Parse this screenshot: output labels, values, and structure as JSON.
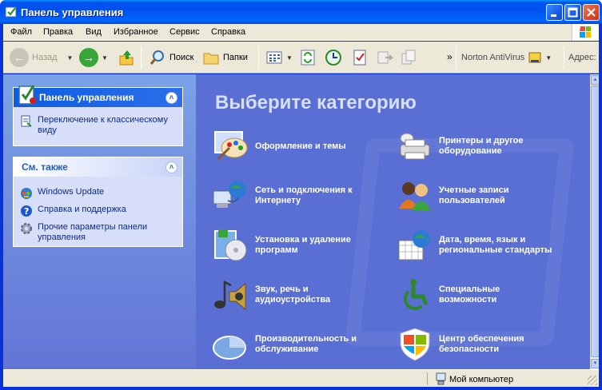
{
  "window": {
    "title": "Панель управления"
  },
  "menu": [
    "Файл",
    "Правка",
    "Вид",
    "Избранное",
    "Сервис",
    "Справка"
  ],
  "toolbar": {
    "back": "Назад",
    "search": "Поиск",
    "folders": "Папки",
    "norton": "Norton AntiVirus",
    "address": "Адрес:",
    "overflow": "»"
  },
  "taskpane": {
    "panel_title": "Панель управления",
    "switch_link": "Переключение к классическому виду",
    "see_also_title": "См. также",
    "see_also": [
      "Windows Update",
      "Справка и поддержка",
      "Прочие параметры панели управления"
    ]
  },
  "main": {
    "heading": "Выберите категорию",
    "categories": [
      {
        "label": "Оформление и темы",
        "icon": "appearance-themes-icon"
      },
      {
        "label": "Принтеры и другое оборудование",
        "icon": "printer-icon"
      },
      {
        "label": "Сеть и подключения к Интернету",
        "icon": "network-icon"
      },
      {
        "label": "Учетные записи пользователей",
        "icon": "user-accounts-icon"
      },
      {
        "label": "Установка и удаление программ",
        "icon": "add-remove-programs-icon"
      },
      {
        "label": "Дата, время, язык и региональные стандарты",
        "icon": "date-time-icon"
      },
      {
        "label": "Звук, речь и аудиоустройства",
        "icon": "sound-icon"
      },
      {
        "label": "Специальные возможности",
        "icon": "accessibility-icon"
      },
      {
        "label": "Производительность и обслуживание",
        "icon": "performance-icon"
      },
      {
        "label": "Центр обеспечения безопасности",
        "icon": "security-center-icon"
      }
    ]
  },
  "statusbar": {
    "zone": "Мой компьютер"
  },
  "colors": {
    "title_bar": "#0053ee",
    "content_bg": "#5a6fd4",
    "task_link": "#0c2a8c",
    "heading": "#d6dff5"
  }
}
